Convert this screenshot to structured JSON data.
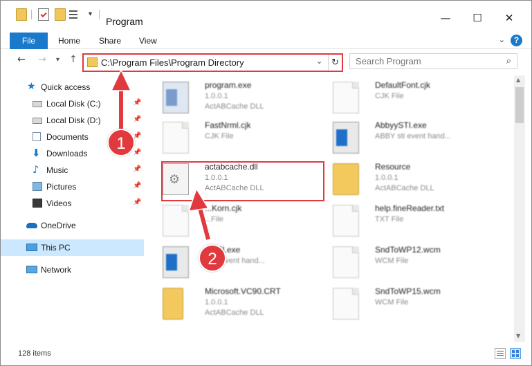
{
  "window": {
    "title": "Program",
    "minimize_glyph": "—",
    "maximize_glyph": "☐",
    "close_glyph": "✕"
  },
  "ribbon": {
    "tabs": [
      "File",
      "Home",
      "Share",
      "View"
    ],
    "help_glyph": "?"
  },
  "nav": {
    "address": "C:\\Program Files\\Program Directory",
    "search_placeholder": "Search Program"
  },
  "sidebar": {
    "items": [
      {
        "label": "Quick access",
        "icon": "star-icon"
      },
      {
        "label": "Local Disk (C:)",
        "icon": "drive-icon"
      },
      {
        "label": "Local Disk (D:)",
        "icon": "drive-icon"
      },
      {
        "label": "Documents",
        "icon": "documents-icon"
      },
      {
        "label": "Downloads",
        "icon": "download-icon"
      },
      {
        "label": "Music",
        "icon": "music-icon"
      },
      {
        "label": "Pictures",
        "icon": "pictures-icon"
      },
      {
        "label": "Videos",
        "icon": "videos-icon"
      },
      {
        "label": "OneDrive",
        "icon": "cloud-icon"
      },
      {
        "label": "This PC",
        "icon": "computer-icon"
      },
      {
        "label": "Network",
        "icon": "network-icon"
      }
    ]
  },
  "files": [
    {
      "name": "program.exe",
      "line2": "1.0.0.1",
      "line3": "ActABCache DLL",
      "icon": "installer-icon"
    },
    {
      "name": "DefaultFont.cjk",
      "line2": "CJK File",
      "line3": "",
      "icon": "document-icon"
    },
    {
      "name": "FastNrml.cjk",
      "line2": "CJK File",
      "line3": "",
      "icon": "document-icon"
    },
    {
      "name": "AbbyySTI.exe",
      "line2": "ABBY sti event hand...",
      "line3": "",
      "icon": "app-window-icon"
    },
    {
      "name": "actabcache.dll",
      "line2": "1.0.0.1",
      "line3": "ActABCache DLL",
      "icon": "gear-file-icon"
    },
    {
      "name": "Resource",
      "line2": "1.0.0.1",
      "line3": "ActABCache DLL",
      "icon": "folder-icon"
    },
    {
      "name": "...Korn.cjk",
      "line2": "...File",
      "line3": "",
      "icon": "document-icon"
    },
    {
      "name": "help.fineReader.txt",
      "line2": "TXT File",
      "line3": "",
      "icon": "document-icon"
    },
    {
      "name": "...STI.exe",
      "line2": "...sti event hand...",
      "line3": "",
      "icon": "app-window-icon"
    },
    {
      "name": "SndToWP12.wcm",
      "line2": "WCM File",
      "line3": "",
      "icon": "document-icon"
    },
    {
      "name": "Microsoft.VC90.CRT",
      "line2": "1.0.0.1",
      "line3": "ActABCache DLL",
      "icon": "folder-icon"
    },
    {
      "name": "SndToWP15.wcm",
      "line2": "WCM File",
      "line3": "",
      "icon": "document-icon"
    }
  ],
  "status": {
    "item_count": "128 items"
  },
  "annotations": {
    "step1": "1",
    "step2": "2",
    "color": "#e0393e"
  },
  "colors": {
    "accent": "#1979ca",
    "selection": "#cce8ff",
    "highlight": "#e0393e"
  }
}
